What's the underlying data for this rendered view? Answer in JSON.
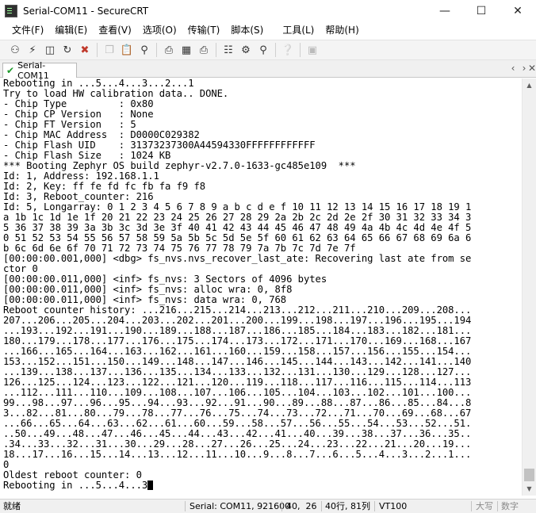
{
  "window": {
    "title": "Serial-COM11 - SecureCRT"
  },
  "menu": [
    {
      "label": "文件(F)"
    },
    {
      "label": "编辑(E)"
    },
    {
      "label": "查看(V)"
    },
    {
      "label": "选项(O)"
    },
    {
      "label": "传输(T)"
    },
    {
      "label": "脚本(S)"
    },
    {
      "label": "工具(L)"
    },
    {
      "label": "帮助(H)"
    }
  ],
  "toolbar": {
    "icons": [
      "connect-icon",
      "quick-connect-icon",
      "connect-tab-icon",
      "reconnect-icon",
      "disconnect-icon",
      "copy-icon",
      "paste-icon",
      "find-icon",
      "print-icon",
      "print-selection-icon",
      "printer-icon",
      "session-options-icon",
      "global-options-icon",
      "keymap-icon",
      "help-icon",
      "sftp-icon"
    ]
  },
  "tab": {
    "label": "Serial-COM11"
  },
  "terminal": {
    "lines": [
      "Rebooting in ...5...4...3...2...1",
      "Try to load HW calibration data.. DONE.",
      "- Chip Type         : 0x80",
      "- Chip CP Version   : None",
      "- Chip FT Version   : 5",
      "- Chip MAC Address  : D0000C029382",
      "- Chip Flash UID    : 31373237300A44594330FFFFFFFFFFFF",
      "- Chip Flash Size   : 1024 KB",
      "*** Booting Zephyr OS build zephyr-v2.7.0-1633-gc485e109  ***",
      "Id: 1, Address: 192.168.1.1",
      "Id: 2, Key: ff fe fd fc fb fa f9 f8",
      "Id: 3, Reboot_counter: 216",
      "Id: 5, Longarray: 0 1 2 3 4 5 6 7 8 9 a b c d e f 10 11 12 13 14 15 16 17 18 19 1",
      "a 1b 1c 1d 1e 1f 20 21 22 23 24 25 26 27 28 29 2a 2b 2c 2d 2e 2f 30 31 32 33 34 3",
      "5 36 37 38 39 3a 3b 3c 3d 3e 3f 40 41 42 43 44 45 46 47 48 49 4a 4b 4c 4d 4e 4f 5",
      "0 51 52 53 54 55 56 57 58 59 5a 5b 5c 5d 5e 5f 60 61 62 63 64 65 66 67 68 69 6a 6",
      "b 6c 6d 6e 6f 70 71 72 73 74 75 76 77 78 79 7a 7b 7c 7d 7e 7f",
      "[00:00:00.001,000] <dbg> fs_nvs.nvs_recover_last_ate: Recovering last ate from se",
      "ctor 0",
      "[00:00:00.011,000] <inf> fs_nvs: 3 Sectors of 4096 bytes",
      "[00:00:00.011,000] <inf> fs_nvs: alloc wra: 0, 8f8",
      "[00:00:00.011,000] <inf> fs_nvs: data wra: 0, 768",
      "Reboot counter history: ...216...215...214...213...212...211...210...209...208...",
      "207...206...205...204...203...202...201...200...199...198...197...196...195...194",
      "...193...192...191...190...189...188...187...186...185...184...183...182...181...",
      "180...179...178...177...176...175...174...173...172...171...170...169...168...167",
      "...166...165...164...163...162...161...160...159...158...157...156...155...154...",
      "153...152...151...150...149...148...147...146...145...144...143...142...141...140",
      "...139...138...137...136...135...134...133...132...131...130...129...128...127...",
      "126...125...124...123...122...121...120...119...118...117...116...115...114...113",
      "...112...111...110...109...108...107...106...105...104...103...102...101...100...",
      "99...98...97...96...95...94...93...92...91...90...89...88...87...86...85...84...8",
      "3...82...81...80...79...78...77...76...75...74...73...72...71...70...69...68...67",
      "...66...65...64...63...62...61...60...59...58...57...56...55...54...53...52...51.",
      "..50...49...48...47...46...45...44...43...42...41...40...39...38...37...36...35..",
      ".34...33...32...31...30...29...28...27...26...25...24...23...22...21...20...19...",
      "18...17...16...15...14...13...12...11...10...9...8...7...6...5...4...3...2...1...",
      "0",
      "Oldest reboot counter: 0",
      "Rebooting in ...5...4...3"
    ]
  },
  "statusbar": {
    "ready": "就绪",
    "connection": "Serial: COM11, 921600",
    "cursor_pos": "40,  26",
    "rows_cols": "40行, 81列",
    "emulation": "VT100",
    "caps": "大写",
    "num": "数字"
  }
}
